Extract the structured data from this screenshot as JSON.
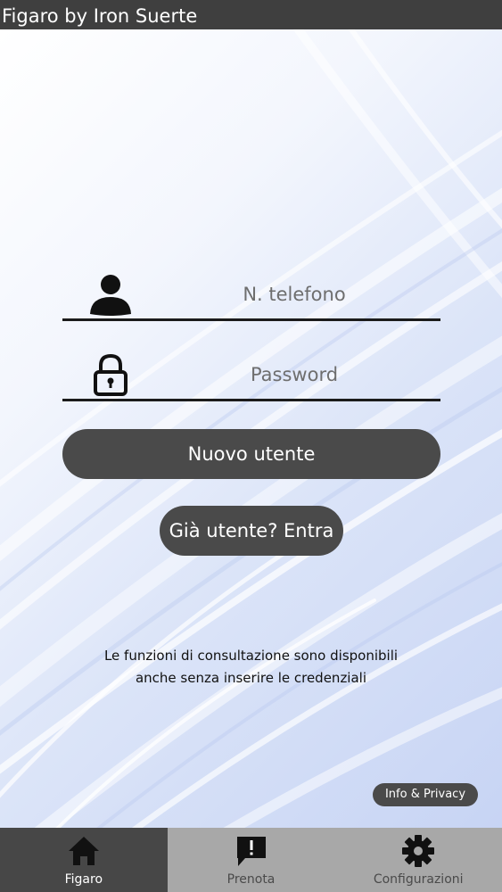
{
  "app": {
    "title": "Figaro by Iron Suerte"
  },
  "login": {
    "phone_placeholder": "N. telefono",
    "password_placeholder": "Password",
    "new_user_label": "Nuovo utente",
    "existing_user_label": "Già utente? Entra"
  },
  "note": {
    "line1": "Le funzioni di consultazione sono disponibili",
    "line2": "anche senza inserire le credenziali"
  },
  "info_label": "Info & Privacy",
  "tabs": [
    {
      "label": "Figaro",
      "icon": "home-icon",
      "active": true
    },
    {
      "label": "Prenota",
      "icon": "chat-alert-icon",
      "active": false
    },
    {
      "label": "Configurazioni",
      "icon": "gear-icon",
      "active": false
    }
  ],
  "colors": {
    "title_bar": "#3f3f3f",
    "button": "#4a4a4a",
    "tab_bar": "#a8a8a8",
    "tab_active": "#474747"
  }
}
